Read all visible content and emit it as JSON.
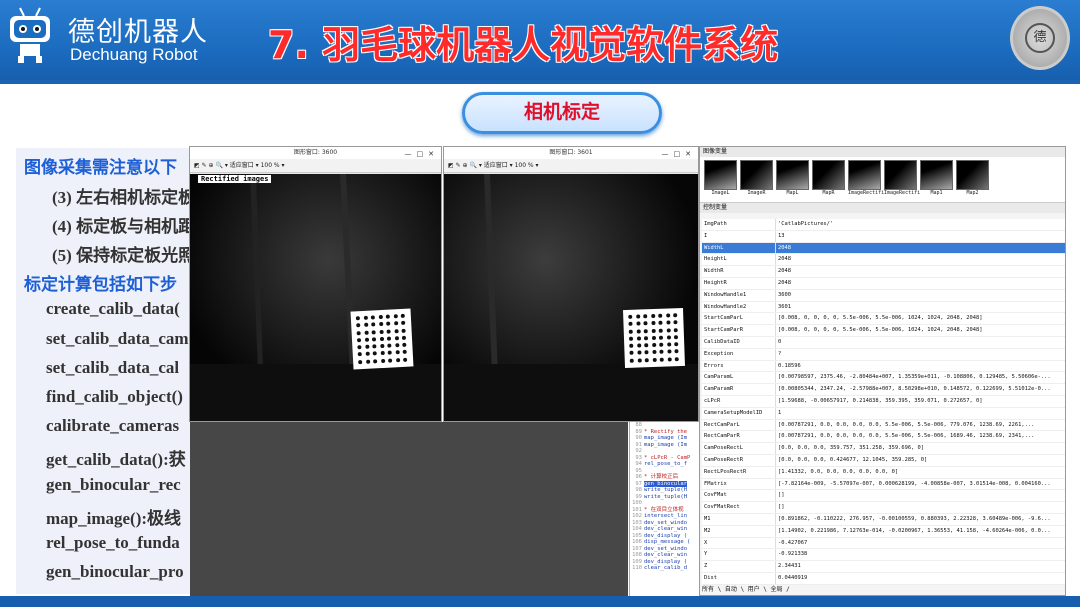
{
  "header": {
    "brand_cn": "德创机器人",
    "brand_en": "Dechuang Robot",
    "title": "7. 羽毛球机器人视觉软件系统",
    "badge_text": "德",
    "colors": {
      "header": "#1c6cc0",
      "title": "#ff2a2a",
      "pill_text": "#e0102a"
    }
  },
  "section_pill": "相机标定",
  "notes": {
    "lines": [
      {
        "text": "图像采集需注意以下",
        "style": "blue"
      },
      {
        "text": "(3) 左右相机标定板",
        "style": "dark"
      },
      {
        "text": "(4) 标定板与相机距",
        "style": "dark"
      },
      {
        "text": "(5) 保持标定板光照",
        "style": "dark"
      },
      {
        "text": "标定计算包括如下步",
        "style": "blue"
      },
      {
        "text": "create_calib_data(",
        "style": "dark"
      },
      {
        "text": "set_calib_data_cam",
        "style": "dark"
      },
      {
        "text": "set_calib_data_cal",
        "style": "dark"
      },
      {
        "text": "find_calib_object()",
        "style": "dark"
      },
      {
        "text": "calibrate_cameras",
        "style": "dark"
      },
      {
        "text": "get_calib_data():获",
        "style": "dark"
      },
      {
        "text": "gen_binocular_rec",
        "style": "dark"
      },
      {
        "text": "map_image():极线",
        "style": "dark"
      },
      {
        "text": "rel_pose_to_funda",
        "style": "dark"
      },
      {
        "text": "gen_binocular_pro",
        "style": "dark"
      }
    ]
  },
  "left_window": {
    "title": "图形窗口: 3600",
    "toolbar": "◩ ✎ ⊕ 🔍 ▾  适应窗口 ▾  100 % ▾",
    "label": "Rectified images"
  },
  "right_window": {
    "title": "图形窗口: 3601",
    "toolbar": "◩ ✎ ⊕ 🔍 ▾  适应窗口 ▾  100 % ▾"
  },
  "code_lines": [
    {
      "n": "88",
      "t": "",
      "c": ""
    },
    {
      "n": "89",
      "t": "* Rectify the",
      "c": "cm"
    },
    {
      "n": "90",
      "t": "map_image (Im",
      "c": "kw"
    },
    {
      "n": "91",
      "t": "map_image (Im",
      "c": "kw"
    },
    {
      "n": "92",
      "t": "",
      "c": ""
    },
    {
      "n": "93",
      "t": "* cLPcR - CamP",
      "c": "cm"
    },
    {
      "n": "94",
      "t": "rel_pose_to_f",
      "c": "kw"
    },
    {
      "n": "95",
      "t": "",
      "c": ""
    },
    {
      "n": "96",
      "t": "* 计算校正后",
      "c": "cm"
    },
    {
      "n": "97",
      "t": "gen_binocular",
      "c": "hl"
    },
    {
      "n": "98",
      "t": "write_tuple(H",
      "c": "kw"
    },
    {
      "n": "99",
      "t": "write_tuple(H",
      "c": "kw"
    },
    {
      "n": "100",
      "t": "",
      "c": ""
    },
    {
      "n": "101",
      "t": "* 在双目立体视",
      "c": "cm"
    },
    {
      "n": "102",
      "t": "intersect_lin",
      "c": "kw"
    },
    {
      "n": "103",
      "t": "dev_set_windo",
      "c": "kw"
    },
    {
      "n": "104",
      "t": "dev_clear_win",
      "c": "kw"
    },
    {
      "n": "105",
      "t": "dev_display (",
      "c": "kw"
    },
    {
      "n": "106",
      "t": "disp_message (",
      "c": "kw"
    },
    {
      "n": "107",
      "t": "dev_set_windo",
      "c": "kw"
    },
    {
      "n": "108",
      "t": "dev_clear_win",
      "c": "kw"
    },
    {
      "n": "109",
      "t": "dev_display (",
      "c": "kw"
    },
    {
      "n": "110",
      "t": "clear_calib_d",
      "c": "kw"
    }
  ],
  "variables": {
    "image_section": "图像变量",
    "control_section": "控制变量",
    "thumbs": [
      "ImageL",
      "ImageR",
      "MapL",
      "MapR",
      "ImageRectifi",
      "ImageRectifi",
      "Map1",
      "Map2"
    ],
    "rows": [
      {
        "n": "ImgPath",
        "v": "'CatlabPictures/'"
      },
      {
        "n": "I",
        "v": "13"
      },
      {
        "n": "WidthL",
        "v": "2048",
        "sel": true
      },
      {
        "n": "HeightL",
        "v": "2048"
      },
      {
        "n": "WidthR",
        "v": "2048"
      },
      {
        "n": "HeightR",
        "v": "2048"
      },
      {
        "n": "WindowHandle1",
        "v": "3600"
      },
      {
        "n": "WindowHandle2",
        "v": "3601"
      },
      {
        "n": "StartCamParL",
        "v": "[0.008, 0, 0, 0, 0, 5.5e-006, 5.5e-006, 1024, 1024, 2048, 2048]"
      },
      {
        "n": "StartCamParR",
        "v": "[0.008, 0, 0, 0, 0, 5.5e-006, 5.5e-006, 1024, 1024, 2048, 2048]"
      },
      {
        "n": "CalibDataID",
        "v": "0"
      },
      {
        "n": "Exception",
        "v": "?"
      },
      {
        "n": "Errors",
        "v": "0.18596"
      },
      {
        "n": "CamParamL",
        "v": "[0.00798597, 2375.46, -2.80484e+007, 1.35359e+011, -0.108806, 0.129485, 5.50606e-..."
      },
      {
        "n": "CamParamR",
        "v": "[0.00805344, 2347.24, -2.57988e+007, 8.50298e+010, 0.148572, 0.122699, 5.51012e-0..."
      },
      {
        "n": "cLPcR",
        "v": "[1.59688, -0.00657917, 0.214838, 359.395, 359.071, 0.272657, 0]"
      },
      {
        "n": "CameraSetupModelID",
        "v": "1"
      },
      {
        "n": "RectCamParL",
        "v": "[0.00787291, 0.0, 0.0, 0.0, 0.0, 5.5e-006, 5.5e-006, 779.076, 1238.69, 2261,..."
      },
      {
        "n": "RectCamParR",
        "v": "[0.00787291, 0.0, 0.0, 0.0, 0.0, 5.5e-006, 5.5e-006, 1689.46, 1238.69, 2341,..."
      },
      {
        "n": "CamPoseRectL",
        "v": "[0.0, 0.0, 0.0, 359.757, 351.258, 359.696, 0]"
      },
      {
        "n": "CamPoseRectR",
        "v": "[0.0, 0.0, 0.0, 0.424677, 12.1045, 359.285, 0]"
      },
      {
        "n": "RectLPosRectR",
        "v": "[1.41332, 0.0, 0.0, 0.0, 0.0, 0.0, 0]"
      },
      {
        "n": "FMatrix",
        "v": "[-7.82164e-009, -5.57097e-007, 0.000628199, -4.00858e-007, 3.01514e-008, 0.004160..."
      },
      {
        "n": "CovFMat",
        "v": "[]"
      },
      {
        "n": "CovFMatRect",
        "v": "[]"
      },
      {
        "n": "M1",
        "v": "[0.891862, -0.110222, 276.957, -0.00100559, 0.880393, 2.22328, 3.60489e-006, -9.6..."
      },
      {
        "n": "M2",
        "v": "[1.14902, 0.221986, 7.12763e-014, -0.0200967, 1.36553, 41.158, -4.60264e-006, 0.0..."
      },
      {
        "n": "X",
        "v": "-0.427067"
      },
      {
        "n": "Y",
        "v": "-0.921338"
      },
      {
        "n": "Z",
        "v": "2.34431"
      },
      {
        "n": "Dist",
        "v": "0.0440919"
      }
    ],
    "tabs": "所有 \\ 自动 \\ 用户 \\ 全局 /"
  }
}
